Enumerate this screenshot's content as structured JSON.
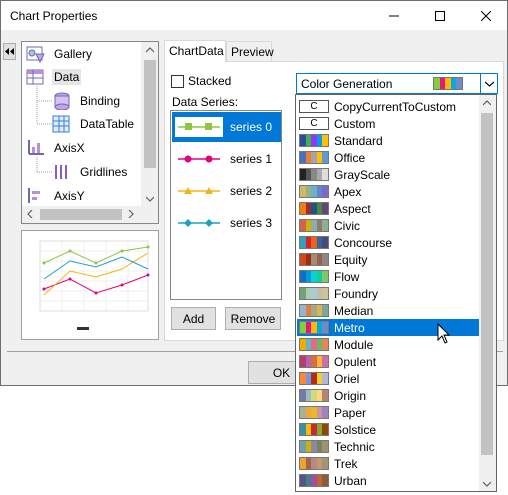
{
  "window": {
    "title": "Chart Properties",
    "minimize_label": "—",
    "maximize_label": "☐",
    "close_label": "✕"
  },
  "tree": {
    "items": [
      {
        "label": "Gallery",
        "icon": "gallery-icon"
      },
      {
        "label": "Data",
        "icon": "data-icon",
        "selected": true
      },
      {
        "label": "Binding",
        "icon": "binding-icon"
      },
      {
        "label": "DataTable",
        "icon": "datatable-icon"
      },
      {
        "label": "AxisX",
        "icon": "axisx-icon"
      },
      {
        "label": "Gridlines",
        "icon": "gridlines-icon"
      },
      {
        "label": "AxisY",
        "icon": "axisy-icon"
      }
    ]
  },
  "tabs": [
    {
      "label": "ChartData",
      "active": true
    },
    {
      "label": "Preview",
      "active": false
    }
  ],
  "data_tab": {
    "stacked_label": "Stacked",
    "stacked_checked": false,
    "series_header": "Data Series:",
    "series": [
      {
        "label": "series 0",
        "color": "#8dc63f",
        "selected": true
      },
      {
        "label": "series 1",
        "color": "#e6007e"
      },
      {
        "label": "series 2",
        "color": "#f5b31b"
      },
      {
        "label": "series 3",
        "color": "#1ba1c9"
      }
    ],
    "add_label": "Add",
    "remove_label": "Remove"
  },
  "color_combo": {
    "value": "Color Generation",
    "arrow": "⌄"
  },
  "dropdown": {
    "items": [
      {
        "label": "CopyCurrentToCustom",
        "swatch_text": "C"
      },
      {
        "label": "Custom",
        "swatch_text": "C"
      },
      {
        "label": "Standard",
        "colors": [
          "#2e4a9e",
          "#3ab54a",
          "#9b30ff",
          "#00a0e3",
          "#ffc000"
        ]
      },
      {
        "label": "Office",
        "colors": [
          "#4472c4",
          "#ed7d31",
          "#a5a5a5",
          "#ffc000",
          "#5b9bd5"
        ]
      },
      {
        "label": "GrayScale",
        "colors": [
          "#222222",
          "#555555",
          "#888888",
          "#aaaaaa",
          "#dddddd"
        ]
      },
      {
        "label": "Apex",
        "colors": [
          "#ceb966",
          "#9cb084",
          "#6bb1c9",
          "#6585cf",
          "#7e6bc9"
        ]
      },
      {
        "label": "Aspect",
        "colors": [
          "#f07f09",
          "#9f2936",
          "#1b587c",
          "#4e8542",
          "#604878"
        ]
      },
      {
        "label": "Civic",
        "colors": [
          "#d16349",
          "#ccb400",
          "#8cadae",
          "#8c7b70",
          "#8fb08c"
        ]
      },
      {
        "label": "Concourse",
        "colors": [
          "#2da2bf",
          "#da1f28",
          "#eb641b",
          "#39639d",
          "#474b78"
        ]
      },
      {
        "label": "Equity",
        "colors": [
          "#d34817",
          "#9b2d1f",
          "#a28e6a",
          "#956251",
          "#918485"
        ]
      },
      {
        "label": "Flow",
        "colors": [
          "#0f6fc6",
          "#009dd9",
          "#0bd0d9",
          "#10cf9b",
          "#7cca62"
        ]
      },
      {
        "label": "Foundry",
        "colors": [
          "#72a376",
          "#b0ccb0",
          "#a8cdd7",
          "#c0beaf",
          "#cec597"
        ]
      },
      {
        "label": "Median",
        "colors": [
          "#94b6d2",
          "#dd8047",
          "#a5ab81",
          "#d8b25c",
          "#7ba79d"
        ]
      },
      {
        "label": "Metro",
        "colors": [
          "#7fd13b",
          "#ea157a",
          "#feb80a",
          "#00addc",
          "#738ac8"
        ],
        "selected": true
      },
      {
        "label": "Module",
        "colors": [
          "#f0ad00",
          "#60b5cc",
          "#e66c7d",
          "#6bb76d",
          "#e88651"
        ]
      },
      {
        "label": "Opulent",
        "colors": [
          "#b83d68",
          "#ac66bb",
          "#de6c36",
          "#f9b639",
          "#cf6da4"
        ]
      },
      {
        "label": "Oriel",
        "colors": [
          "#fe8637",
          "#7598d9",
          "#b32c16",
          "#f5cd2d",
          "#aebad5"
        ]
      },
      {
        "label": "Origin",
        "colors": [
          "#727ca3",
          "#9fb8cd",
          "#d2da7a",
          "#fada7a",
          "#b88472"
        ]
      },
      {
        "label": "Paper",
        "colors": [
          "#a5b592",
          "#f3a447",
          "#e7bc29",
          "#d092a7",
          "#9c85c0"
        ]
      },
      {
        "label": "Solstice",
        "colors": [
          "#3891a7",
          "#feb80a",
          "#c32d2e",
          "#84aa33",
          "#964305"
        ]
      },
      {
        "label": "Technic",
        "colors": [
          "#6ea0b0",
          "#ccaf0a",
          "#8d89a4",
          "#748560",
          "#9e9273"
        ]
      },
      {
        "label": "Trek",
        "colors": [
          "#f0a22e",
          "#a5644e",
          "#b58b80",
          "#c3986d",
          "#a19574"
        ]
      },
      {
        "label": "Urban",
        "colors": [
          "#53548a",
          "#438086",
          "#a04da3",
          "#c4652d",
          "#8b5d3d"
        ]
      }
    ]
  },
  "footer": {
    "ok_label": "OK"
  }
}
